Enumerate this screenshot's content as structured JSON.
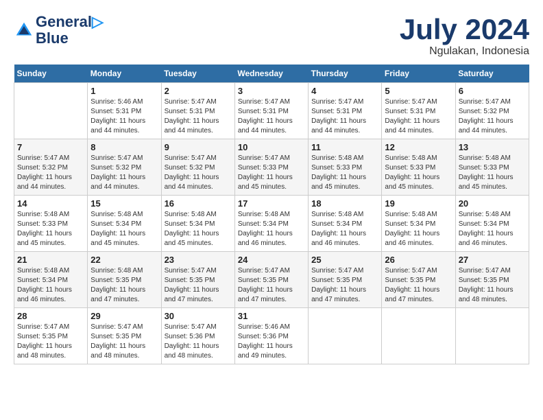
{
  "header": {
    "logo_line1": "General",
    "logo_line2": "Blue",
    "month_year": "July 2024",
    "location": "Ngulakan, Indonesia"
  },
  "days_of_week": [
    "Sunday",
    "Monday",
    "Tuesday",
    "Wednesday",
    "Thursday",
    "Friday",
    "Saturday"
  ],
  "weeks": [
    [
      {
        "num": "",
        "info": ""
      },
      {
        "num": "1",
        "info": "Sunrise: 5:46 AM\nSunset: 5:31 PM\nDaylight: 11 hours\nand 44 minutes."
      },
      {
        "num": "2",
        "info": "Sunrise: 5:47 AM\nSunset: 5:31 PM\nDaylight: 11 hours\nand 44 minutes."
      },
      {
        "num": "3",
        "info": "Sunrise: 5:47 AM\nSunset: 5:31 PM\nDaylight: 11 hours\nand 44 minutes."
      },
      {
        "num": "4",
        "info": "Sunrise: 5:47 AM\nSunset: 5:31 PM\nDaylight: 11 hours\nand 44 minutes."
      },
      {
        "num": "5",
        "info": "Sunrise: 5:47 AM\nSunset: 5:31 PM\nDaylight: 11 hours\nand 44 minutes."
      },
      {
        "num": "6",
        "info": "Sunrise: 5:47 AM\nSunset: 5:32 PM\nDaylight: 11 hours\nand 44 minutes."
      }
    ],
    [
      {
        "num": "7",
        "info": "Sunrise: 5:47 AM\nSunset: 5:32 PM\nDaylight: 11 hours\nand 44 minutes."
      },
      {
        "num": "8",
        "info": "Sunrise: 5:47 AM\nSunset: 5:32 PM\nDaylight: 11 hours\nand 44 minutes."
      },
      {
        "num": "9",
        "info": "Sunrise: 5:47 AM\nSunset: 5:32 PM\nDaylight: 11 hours\nand 44 minutes."
      },
      {
        "num": "10",
        "info": "Sunrise: 5:47 AM\nSunset: 5:33 PM\nDaylight: 11 hours\nand 45 minutes."
      },
      {
        "num": "11",
        "info": "Sunrise: 5:48 AM\nSunset: 5:33 PM\nDaylight: 11 hours\nand 45 minutes."
      },
      {
        "num": "12",
        "info": "Sunrise: 5:48 AM\nSunset: 5:33 PM\nDaylight: 11 hours\nand 45 minutes."
      },
      {
        "num": "13",
        "info": "Sunrise: 5:48 AM\nSunset: 5:33 PM\nDaylight: 11 hours\nand 45 minutes."
      }
    ],
    [
      {
        "num": "14",
        "info": "Sunrise: 5:48 AM\nSunset: 5:33 PM\nDaylight: 11 hours\nand 45 minutes."
      },
      {
        "num": "15",
        "info": "Sunrise: 5:48 AM\nSunset: 5:34 PM\nDaylight: 11 hours\nand 45 minutes."
      },
      {
        "num": "16",
        "info": "Sunrise: 5:48 AM\nSunset: 5:34 PM\nDaylight: 11 hours\nand 45 minutes."
      },
      {
        "num": "17",
        "info": "Sunrise: 5:48 AM\nSunset: 5:34 PM\nDaylight: 11 hours\nand 46 minutes."
      },
      {
        "num": "18",
        "info": "Sunrise: 5:48 AM\nSunset: 5:34 PM\nDaylight: 11 hours\nand 46 minutes."
      },
      {
        "num": "19",
        "info": "Sunrise: 5:48 AM\nSunset: 5:34 PM\nDaylight: 11 hours\nand 46 minutes."
      },
      {
        "num": "20",
        "info": "Sunrise: 5:48 AM\nSunset: 5:34 PM\nDaylight: 11 hours\nand 46 minutes."
      }
    ],
    [
      {
        "num": "21",
        "info": "Sunrise: 5:48 AM\nSunset: 5:34 PM\nDaylight: 11 hours\nand 46 minutes."
      },
      {
        "num": "22",
        "info": "Sunrise: 5:48 AM\nSunset: 5:35 PM\nDaylight: 11 hours\nand 47 minutes."
      },
      {
        "num": "23",
        "info": "Sunrise: 5:47 AM\nSunset: 5:35 PM\nDaylight: 11 hours\nand 47 minutes."
      },
      {
        "num": "24",
        "info": "Sunrise: 5:47 AM\nSunset: 5:35 PM\nDaylight: 11 hours\nand 47 minutes."
      },
      {
        "num": "25",
        "info": "Sunrise: 5:47 AM\nSunset: 5:35 PM\nDaylight: 11 hours\nand 47 minutes."
      },
      {
        "num": "26",
        "info": "Sunrise: 5:47 AM\nSunset: 5:35 PM\nDaylight: 11 hours\nand 47 minutes."
      },
      {
        "num": "27",
        "info": "Sunrise: 5:47 AM\nSunset: 5:35 PM\nDaylight: 11 hours\nand 48 minutes."
      }
    ],
    [
      {
        "num": "28",
        "info": "Sunrise: 5:47 AM\nSunset: 5:35 PM\nDaylight: 11 hours\nand 48 minutes."
      },
      {
        "num": "29",
        "info": "Sunrise: 5:47 AM\nSunset: 5:35 PM\nDaylight: 11 hours\nand 48 minutes."
      },
      {
        "num": "30",
        "info": "Sunrise: 5:47 AM\nSunset: 5:36 PM\nDaylight: 11 hours\nand 48 minutes."
      },
      {
        "num": "31",
        "info": "Sunrise: 5:46 AM\nSunset: 5:36 PM\nDaylight: 11 hours\nand 49 minutes."
      },
      {
        "num": "",
        "info": ""
      },
      {
        "num": "",
        "info": ""
      },
      {
        "num": "",
        "info": ""
      }
    ]
  ]
}
